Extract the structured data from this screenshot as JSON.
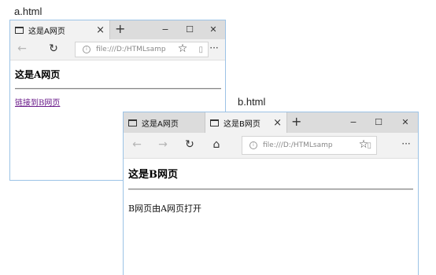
{
  "captions": {
    "a": "a.html",
    "b": "b.html"
  },
  "window_a": {
    "tabs": [
      {
        "title": "这是A网页",
        "active": true
      }
    ],
    "new_tab_glyph": "+",
    "controls": {
      "minimize": "−",
      "maximize": "☐",
      "close": "✕"
    },
    "toolbar_icons": [
      "back-icon",
      "refresh-icon"
    ],
    "address": {
      "text": "file:///D:/HTMLsamp"
    },
    "more_glyph": "···",
    "star_glyph": "☆",
    "page": {
      "heading": "这是A网页",
      "link": "链接到B网页"
    }
  },
  "window_b": {
    "tabs": [
      {
        "title": "这是A网页",
        "active": false
      },
      {
        "title": "这是B网页",
        "active": true
      }
    ],
    "new_tab_glyph": "+",
    "controls": {
      "minimize": "−",
      "maximize": "☐",
      "close": "✕"
    },
    "toolbar_icons": [
      "back-icon",
      "forward-icon",
      "refresh-icon",
      "home-icon"
    ],
    "address": {
      "text": "file:///D:/HTMLsamp"
    },
    "more_glyph": "···",
    "star_glyph": "☆",
    "page": {
      "heading": "这是B网页",
      "text": "B网页由A网页打开"
    }
  },
  "colors": {
    "window_border": "#9cc3e6",
    "tabbar": "#dcdcdc",
    "toolbar": "#f2f2f2",
    "visited_link": "#6a1b8a"
  }
}
